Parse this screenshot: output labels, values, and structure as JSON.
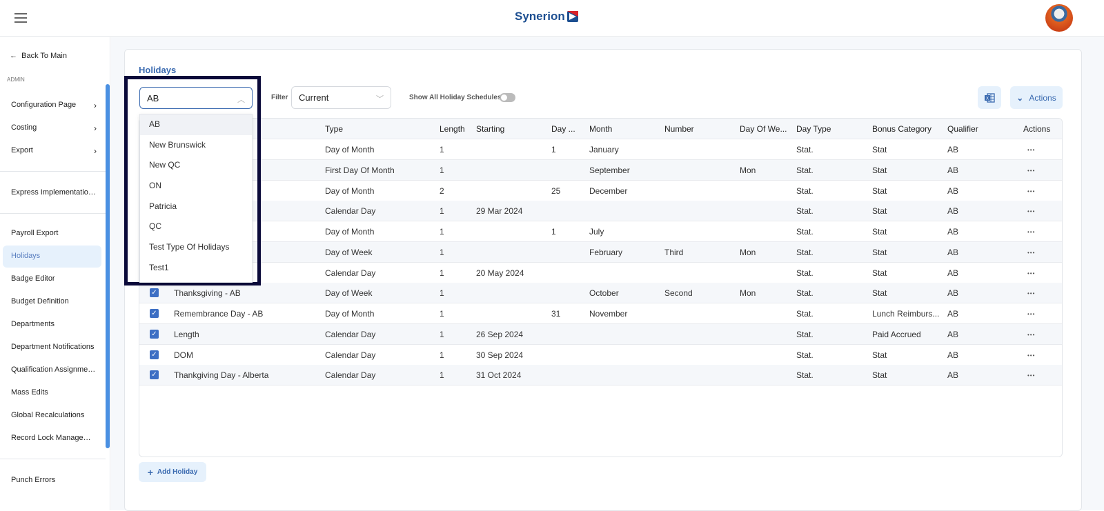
{
  "header": {
    "logo": "Synerion",
    "menu_icon": "hamburger-icon",
    "avatar": "user-avatar"
  },
  "sidebar": {
    "back": "Back To Main",
    "section": "ADMIN",
    "items": [
      {
        "label": "Configuration Page",
        "chevron": true
      },
      {
        "label": "Costing",
        "chevron": true
      },
      {
        "label": "Export",
        "chevron": true
      },
      {
        "label": "Express Implementation P..."
      },
      {
        "label": "Payroll Export"
      },
      {
        "label": "Holidays",
        "active": true
      },
      {
        "label": "Badge Editor"
      },
      {
        "label": "Budget Definition"
      },
      {
        "label": "Departments"
      },
      {
        "label": "Department Notifications"
      },
      {
        "label": "Qualification Assignments"
      },
      {
        "label": "Mass Edits"
      },
      {
        "label": "Global Recalculations"
      },
      {
        "label": "Record Lock Management"
      },
      {
        "label": "Punch Errors"
      }
    ]
  },
  "page": {
    "title": "Holidays",
    "schedule_value": "AB",
    "filter_label": "Filter",
    "filter_value": "Current",
    "toggle_label": "Show All Holiday Schedules",
    "toggle_on": false,
    "actions_label": "Actions",
    "add_label": "Add Holiday",
    "accent": "#3a6ab0"
  },
  "dropdown": {
    "options": [
      "AB",
      "New Brunswick",
      "New QC",
      "ON",
      "Patricia",
      "QC",
      "Test Type Of Holidays",
      "Test1"
    ],
    "selected": "AB"
  },
  "table": {
    "columns": [
      "",
      "Type",
      "Length",
      "Starting",
      "Day ...",
      "Month",
      "Number",
      "Day Of We...",
      "Day Type",
      "Bonus Category",
      "Qualifier",
      "Actions"
    ],
    "rows": [
      [
        "",
        "Day of Month",
        "1",
        "",
        "1",
        "January",
        "",
        "",
        "Stat.",
        "Stat",
        "AB"
      ],
      [
        "",
        "First Day Of Month",
        "1",
        "",
        "",
        "September",
        "",
        "Mon",
        "Stat.",
        "Stat",
        "AB"
      ],
      [
        "",
        "Day of Month",
        "2",
        "",
        "25",
        "December",
        "",
        "",
        "Stat.",
        "Stat",
        "AB"
      ],
      [
        "",
        "Calendar Day",
        "1",
        "29 Mar 2024",
        "",
        "",
        "",
        "",
        "Stat.",
        "Stat",
        "AB"
      ],
      [
        "",
        "Day of Month",
        "1",
        "",
        "1",
        "July",
        "",
        "",
        "Stat.",
        "Stat",
        "AB"
      ],
      [
        "",
        "Day of Week",
        "1",
        "",
        "",
        "February",
        "Third",
        "Mon",
        "Stat.",
        "Stat",
        "AB"
      ],
      [
        "",
        "Calendar Day",
        "1",
        "20 May 2024",
        "",
        "",
        "",
        "",
        "Stat.",
        "Stat",
        "AB"
      ],
      [
        "Thanksgiving - AB",
        "Day of Week",
        "1",
        "",
        "",
        "October",
        "Second",
        "Mon",
        "Stat.",
        "Stat",
        "AB"
      ],
      [
        "Remembrance Day - AB",
        "Day of Month",
        "1",
        "",
        "31",
        "November",
        "",
        "",
        "Stat.",
        "Lunch Reimburs...",
        "AB"
      ],
      [
        "Length",
        "Calendar Day",
        "1",
        "26 Sep 2024",
        "",
        "",
        "",
        "",
        "Stat.",
        "Paid Accrued",
        "AB"
      ],
      [
        "DOM",
        "Calendar Day",
        "1",
        "30 Sep 2024",
        "",
        "",
        "",
        "",
        "Stat.",
        "Stat",
        "AB"
      ],
      [
        "Thankgiving Day - Alberta",
        "Calendar Day",
        "1",
        "31 Oct 2024",
        "",
        "",
        "",
        "",
        "Stat.",
        "Stat",
        "AB"
      ]
    ]
  }
}
